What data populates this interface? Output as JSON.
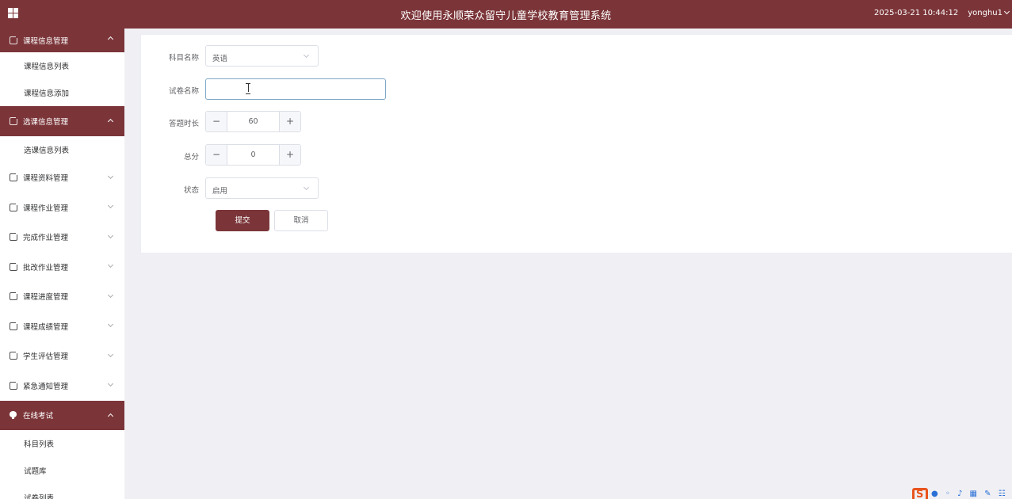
{
  "header": {
    "title": "欢迎使用永顺荣众留守儿童学校教育管理系统",
    "datetime": "2025-03-21 10:44:12",
    "username": "yonghu1"
  },
  "sidebar": {
    "items": [
      {
        "label": "课程信息管理",
        "type": "group",
        "expanded": true
      },
      {
        "label": "课程信息列表",
        "type": "sub"
      },
      {
        "label": "课程信息添加",
        "type": "sub"
      },
      {
        "label": "选课信息管理",
        "type": "group",
        "expanded": true
      },
      {
        "label": "选课信息列表",
        "type": "sub"
      },
      {
        "label": "课程资料管理",
        "type": "group"
      },
      {
        "label": "课程作业管理",
        "type": "group"
      },
      {
        "label": "完成作业管理",
        "type": "group"
      },
      {
        "label": "批改作业管理",
        "type": "group"
      },
      {
        "label": "课程进度管理",
        "type": "group"
      },
      {
        "label": "课程成绩管理",
        "type": "group"
      },
      {
        "label": "学生评估管理",
        "type": "group"
      },
      {
        "label": "紧急通知管理",
        "type": "group"
      },
      {
        "label": "在线考试",
        "type": "group",
        "expanded": true
      },
      {
        "label": "科目列表",
        "type": "sub"
      },
      {
        "label": "试题库",
        "type": "sub"
      },
      {
        "label": "试卷列表",
        "type": "sub"
      }
    ]
  },
  "form": {
    "subject": {
      "label": "科目名称",
      "value": "英语"
    },
    "paper_name": {
      "label": "试卷名称",
      "value": ""
    },
    "duration": {
      "label": "答题时长",
      "value": "60"
    },
    "total_score": {
      "label": "总分",
      "value": "0"
    },
    "status": {
      "label": "状态",
      "value": "启用"
    },
    "submit_label": "提交",
    "cancel_label": "取消"
  },
  "colors": {
    "brand": "#7b3539",
    "background": "#f0f0f4"
  }
}
